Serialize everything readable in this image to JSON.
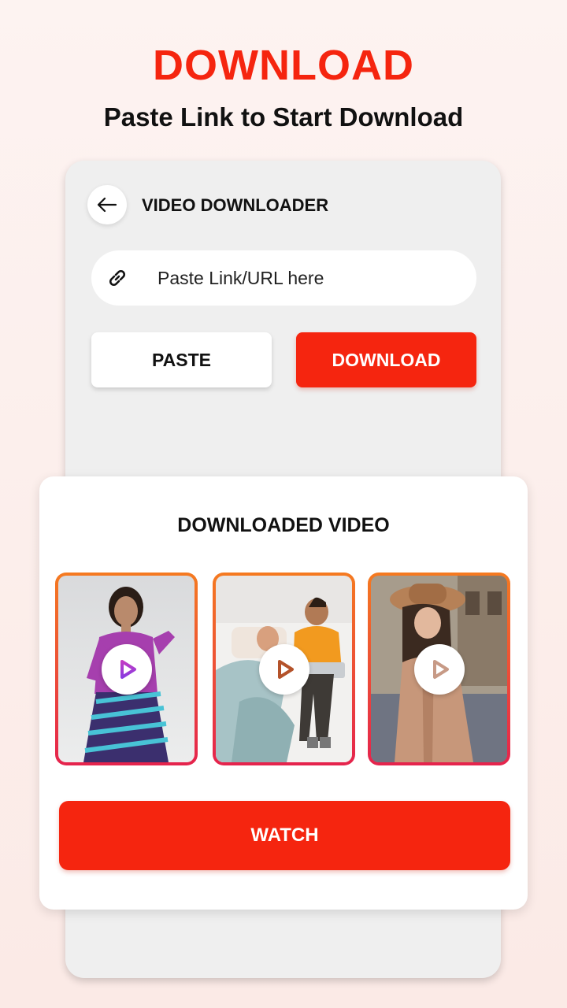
{
  "promo": {
    "headline": "DOWNLOAD",
    "subheadline": "Paste Link to Start Download"
  },
  "app": {
    "title": "VIDEO DOWNLOADER",
    "back_icon": "arrow-left-icon"
  },
  "url_input": {
    "icon": "link-icon",
    "value": "",
    "placeholder": "Paste Link/URL here"
  },
  "actions": {
    "paste_label": "PASTE",
    "download_label": "DOWNLOAD"
  },
  "downloaded": {
    "title": "DOWNLOADED VIDEO",
    "videos": [
      {
        "thumb": "woman-purple-sweater-striped-skirt",
        "icon": "play-icon"
      },
      {
        "thumb": "couple-on-bed-with-laptop",
        "icon": "play-icon"
      },
      {
        "thumb": "woman-brown-hat-coat-street",
        "icon": "play-icon"
      }
    ],
    "watch_label": "WATCH"
  },
  "colors": {
    "accent": "#f5250f",
    "thumb_border_top": "#f57a20",
    "thumb_border_bottom": "#e5234d",
    "background": "#fdf3f1"
  }
}
